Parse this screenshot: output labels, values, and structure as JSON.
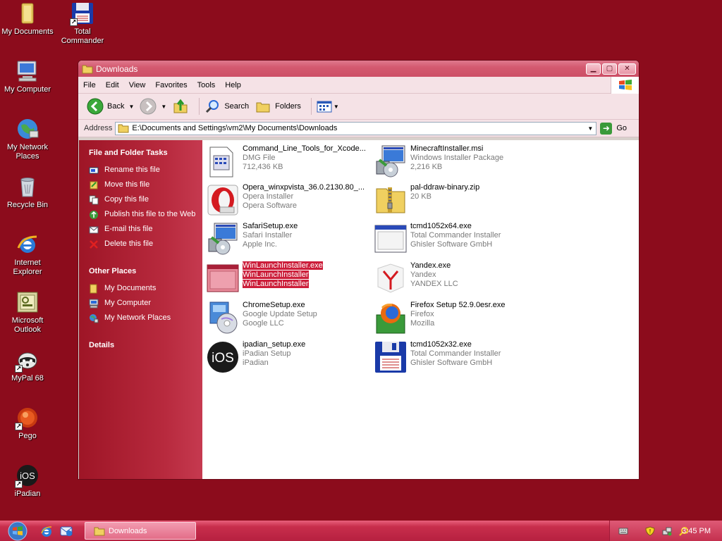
{
  "desktop": {
    "icons": [
      {
        "label": "My Documents",
        "icon": "folder-documents-icon"
      },
      {
        "label": "Total Commander",
        "icon": "floppy-disk-icon"
      },
      {
        "label": "My Computer",
        "icon": "computer-icon"
      },
      {
        "label": "My Network Places",
        "icon": "network-globe-icon"
      },
      {
        "label": "Recycle Bin",
        "icon": "recycle-bin-icon"
      },
      {
        "label": "Internet Explorer",
        "icon": "ie-icon"
      },
      {
        "label": "Microsoft Outlook",
        "icon": "outlook-icon"
      },
      {
        "label": "MyPal 68",
        "icon": "raccoon-icon"
      },
      {
        "label": "Pego",
        "icon": "pego-icon"
      },
      {
        "label": "iPadian",
        "icon": "ios-icon"
      }
    ]
  },
  "window": {
    "title": "Downloads",
    "menu": [
      "File",
      "Edit",
      "View",
      "Favorites",
      "Tools",
      "Help"
    ],
    "toolbar": {
      "back": "Back",
      "search": "Search",
      "folders": "Folders"
    },
    "address": {
      "label": "Address",
      "value": "E:\\Documents and Settings\\vm2\\My Documents\\Downloads",
      "go": "Go"
    }
  },
  "taskpane": {
    "file_tasks_header": "File and Folder Tasks",
    "file_tasks": [
      {
        "label": "Rename this file",
        "icon": "rename-icon"
      },
      {
        "label": "Move this file",
        "icon": "move-icon"
      },
      {
        "label": "Copy this file",
        "icon": "copy-icon"
      },
      {
        "label": "Publish this file to the Web",
        "icon": "publish-web-icon"
      },
      {
        "label": "E-mail this file",
        "icon": "email-icon"
      },
      {
        "label": "Delete this file",
        "icon": "delete-icon"
      }
    ],
    "other_places_header": "Other Places",
    "other_places": [
      {
        "label": "My Documents",
        "icon": "folder-icon"
      },
      {
        "label": "My Computer",
        "icon": "computer-icon"
      },
      {
        "label": "My Network Places",
        "icon": "network-icon"
      }
    ],
    "details_header": "Details"
  },
  "files": [
    {
      "name": "Command_Line_Tools_for_Xcode...",
      "type": "DMG File",
      "info": "712,436 KB",
      "icon": "dmg-file-icon"
    },
    {
      "name": "MinecraftInstaller.msi",
      "type": "Windows Installer Package",
      "info": "2,216 KB",
      "icon": "msi-installer-icon"
    },
    {
      "name": "Opera_winxpvista_36.0.2130.80_...",
      "type": "Opera Installer",
      "info": "Opera Software",
      "icon": "opera-icon"
    },
    {
      "name": "pal-ddraw-binary.zip",
      "type": "20 KB",
      "info": "",
      "icon": "zip-folder-icon"
    },
    {
      "name": "SafariSetup.exe",
      "type": "Safari Installer",
      "info": "Apple Inc.",
      "icon": "installer-icon"
    },
    {
      "name": "tcmd1052x64.exe",
      "type": "Total Commander Installer",
      "info": "Ghisler Software GmbH",
      "icon": "window-app-icon"
    },
    {
      "name": "WinLaunchInstaller.exe",
      "type": "WinLaunchInstaller",
      "info": "WinLaunchInstaller",
      "icon": "window-app-icon",
      "selected": true
    },
    {
      "name": "Yandex.exe",
      "type": "Yandex",
      "info": "YANDEX LLC",
      "icon": "yandex-icon"
    },
    {
      "name": "ChromeSetup.exe",
      "type": "Google Update Setup",
      "info": "Google LLC",
      "icon": "installer-cd-icon"
    },
    {
      "name": "Firefox Setup 52.9.0esr.exe",
      "type": "Firefox",
      "info": "Mozilla",
      "icon": "firefox-icon"
    },
    {
      "name": "ipadian_setup.exe",
      "type": "iPadian Setup",
      "info": "iPadian",
      "icon": "ios-icon"
    },
    {
      "name": "tcmd1052x32.exe",
      "type": "Total Commander Installer",
      "info": "Ghisler Software GmbH",
      "icon": "floppy-disk-icon"
    }
  ],
  "taskbar": {
    "task_label": "Downloads",
    "clock": "3:45 PM"
  },
  "colors": {
    "desktop": "#8c0c1c",
    "title": "#d45a70",
    "taskpane": "#b82a3e",
    "selection": "#cc1e3a"
  }
}
